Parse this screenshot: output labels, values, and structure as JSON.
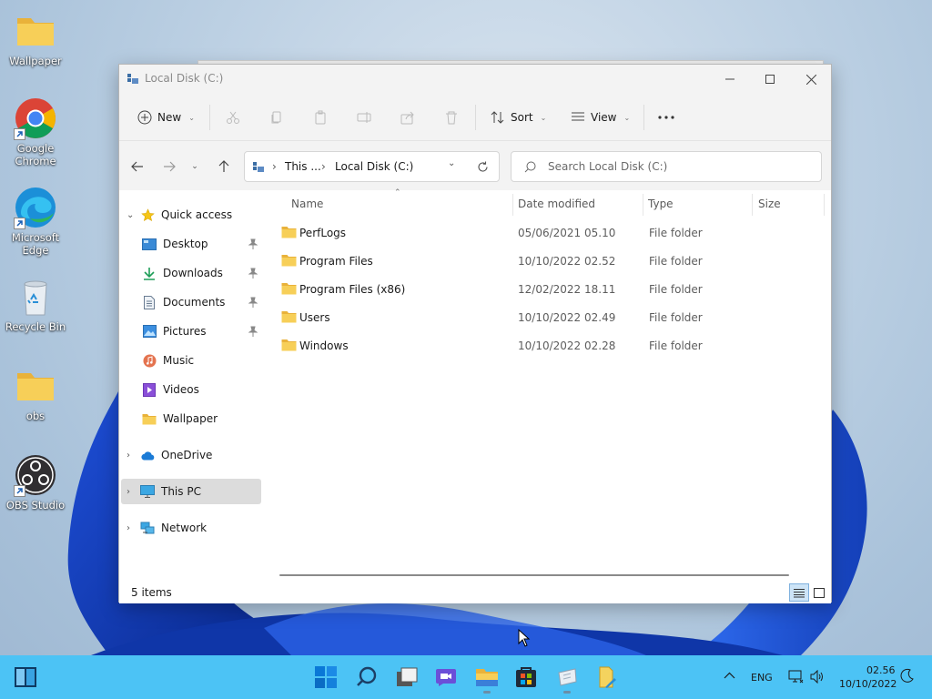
{
  "desktop": {
    "icons": [
      {
        "label": "Wallpaper",
        "icon": "folder-icon"
      },
      {
        "label": "Google Chrome",
        "icon": "chrome-icon",
        "shortcut": true
      },
      {
        "label": "Microsoft Edge",
        "icon": "edge-icon",
        "shortcut": true
      },
      {
        "label": "Recycle Bin",
        "icon": "recycle-bin-icon"
      },
      {
        "label": "obs",
        "icon": "folder-icon"
      },
      {
        "label": "OBS Studio",
        "icon": "obs-icon",
        "shortcut": true
      }
    ]
  },
  "window": {
    "title": "Local Disk (C:)",
    "controls": {
      "minimize": "minimize-icon",
      "maximize": "maximize-icon",
      "close": "close-icon"
    }
  },
  "ribbon": {
    "new_label": "New",
    "sort_label": "Sort",
    "view_label": "View",
    "disabled_actions": [
      "cut",
      "copy",
      "paste",
      "rename",
      "share",
      "delete"
    ]
  },
  "address": {
    "crumbs": [
      "This ...",
      "Local Disk (C:)"
    ],
    "search_placeholder": "Search Local Disk (C:)"
  },
  "sidebar": {
    "quick_access": "Quick access",
    "items": [
      {
        "label": "Desktop",
        "icon": "desktop-icon",
        "pinned": true
      },
      {
        "label": "Downloads",
        "icon": "download-icon",
        "pinned": true
      },
      {
        "label": "Documents",
        "icon": "document-icon",
        "pinned": true
      },
      {
        "label": "Pictures",
        "icon": "picture-icon",
        "pinned": true
      },
      {
        "label": "Music",
        "icon": "music-icon",
        "pinned": false
      },
      {
        "label": "Videos",
        "icon": "video-icon",
        "pinned": false
      },
      {
        "label": "Wallpaper",
        "icon": "folder-icon",
        "pinned": false
      }
    ],
    "onedrive": "OneDrive",
    "this_pc": "This PC",
    "network": "Network"
  },
  "columns": {
    "name": "Name",
    "date": "Date modified",
    "type": "Type",
    "size": "Size"
  },
  "files": [
    {
      "name": "PerfLogs",
      "date": "05/06/2021 05.10",
      "type": "File folder"
    },
    {
      "name": "Program Files",
      "date": "10/10/2022 02.52",
      "type": "File folder"
    },
    {
      "name": "Program Files (x86)",
      "date": "12/02/2022 18.11",
      "type": "File folder"
    },
    {
      "name": "Users",
      "date": "10/10/2022 02.49",
      "type": "File folder"
    },
    {
      "name": "Windows",
      "date": "10/10/2022 02.28",
      "type": "File folder"
    }
  ],
  "status": {
    "count": "5 items"
  },
  "taskbar": {
    "apps": [
      "widgets-icon",
      "start-icon",
      "search-icon",
      "task-view-icon",
      "chat-icon",
      "file-explorer-icon",
      "store-icon",
      "recycle-app-icon",
      "notepad-icon"
    ],
    "language": "ENG",
    "time": "02.56",
    "date": "10/10/2022"
  },
  "colors": {
    "taskbar": "#4cc3f5",
    "accent": "#0067c0",
    "folder": "#f7c948"
  }
}
